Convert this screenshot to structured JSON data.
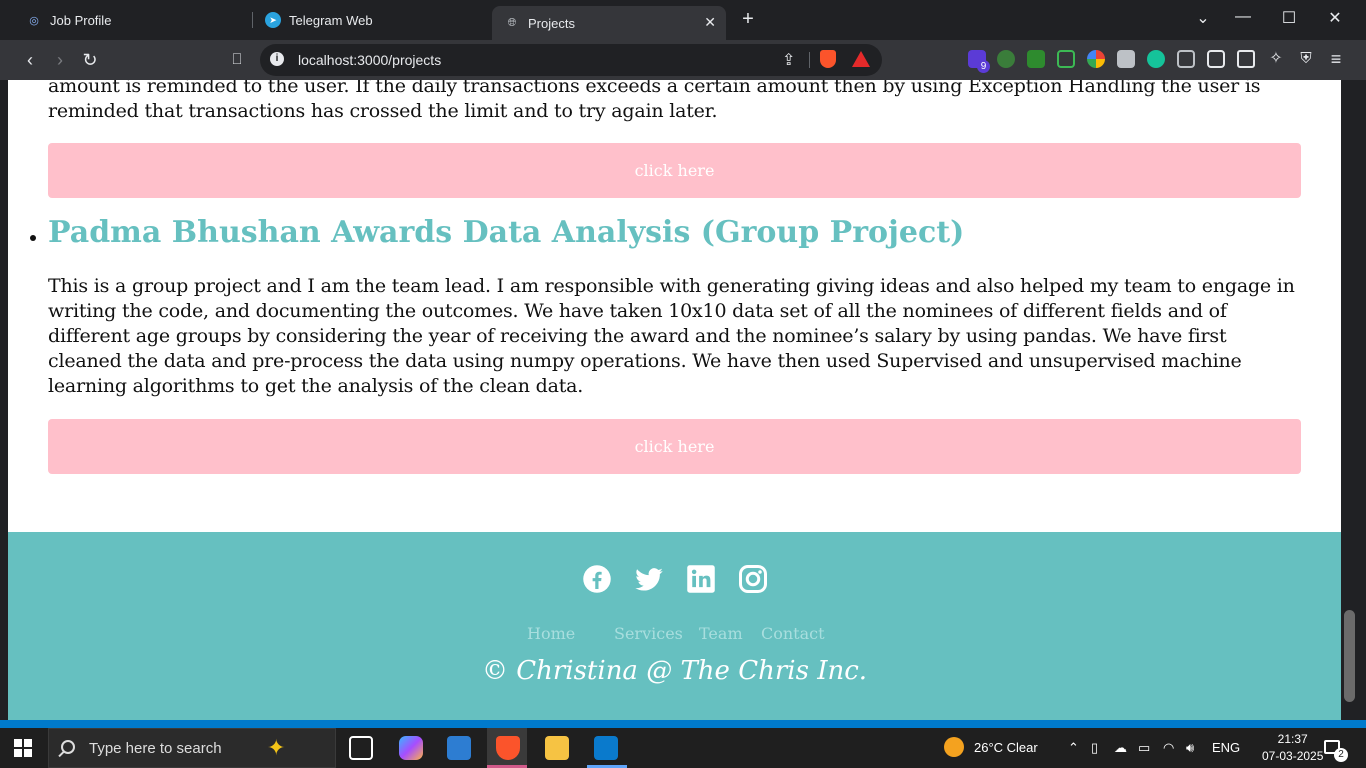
{
  "tabs": [
    {
      "label": "Job Profile"
    },
    {
      "label": "Telegram Web"
    },
    {
      "label": "Projects"
    }
  ],
  "omnibox": {
    "url": "localhost:3000/projects"
  },
  "extensions": {
    "badge_count": "9"
  },
  "page": {
    "top_paragraph": "amount is reminded to the user. If the daily transactions exceeds a certain amount then by using Exception Handling the user is reminded that transactions has crossed the limit and to try again later.",
    "button1_label": "click here",
    "project_title": "Padma Bhushan Awards Data Analysis (Group Project)",
    "project_desc": "This is a group project and I am the team lead. I am responsible with generating giving ideas and also helped my team to engage in writing the code, and documenting the outcomes. We have taken 10x10 data set of all the nominees of different fields and of different age groups by considering the year of receiving the award and the nominee’s salary by using pandas. We have first cleaned the data and pre-process the data using numpy operations. We have then used Supervised and unsupervised machine learning algorithms to get the analysis of the clean data.",
    "button2_label": "click here"
  },
  "footer": {
    "nav": [
      "Home",
      "Services",
      "Team",
      "Contact"
    ],
    "copyright": "© Christina @ The Chris Inc.",
    "social": [
      "facebook-icon",
      "twitter-icon",
      "linkedin-icon",
      "instagram-icon"
    ]
  },
  "taskbar": {
    "search_placeholder": "Type here to search",
    "weather": "26°C  Clear",
    "language": "ENG",
    "time": "21:37",
    "date": "07-03-2025",
    "notifications": "2"
  },
  "colors": {
    "accent_teal": "#66c0c0",
    "button_pink": "#ffc0cb"
  }
}
